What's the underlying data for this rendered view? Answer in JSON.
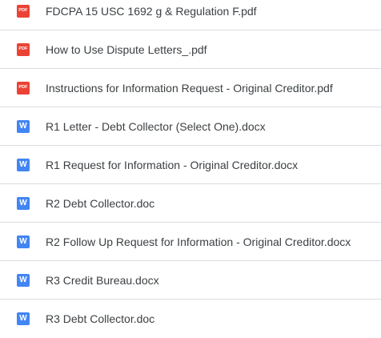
{
  "files": [
    {
      "name": "FDCPA 15 USC 1692 g & Regulation F.pdf",
      "type": "pdf",
      "icon": "pdf-icon",
      "icon_text": "PDF",
      "icon_color": "#ea4335"
    },
    {
      "name": "How to Use Dispute Letters_.pdf",
      "type": "pdf",
      "icon": "pdf-icon",
      "icon_text": "PDF",
      "icon_color": "#ea4335"
    },
    {
      "name": "Instructions for Information Request - Original Creditor.pdf",
      "type": "pdf",
      "icon": "pdf-icon",
      "icon_text": "PDF",
      "icon_color": "#ea4335"
    },
    {
      "name": "R1 Letter - Debt Collector (Select One).docx",
      "type": "word",
      "icon": "word-icon",
      "icon_text": "W",
      "icon_color": "#4285f4"
    },
    {
      "name": "R1 Request for Information - Original Creditor.docx",
      "type": "word",
      "icon": "word-icon",
      "icon_text": "W",
      "icon_color": "#4285f4"
    },
    {
      "name": "R2 Debt Collector.doc",
      "type": "word",
      "icon": "word-icon",
      "icon_text": "W",
      "icon_color": "#4285f4"
    },
    {
      "name": "R2 Follow Up Request for Information - Original Creditor.docx",
      "type": "word",
      "icon": "word-icon",
      "icon_text": "W",
      "icon_color": "#4285f4"
    },
    {
      "name": "R3 Credit Bureau.docx",
      "type": "word",
      "icon": "word-icon",
      "icon_text": "W",
      "icon_color": "#4285f4"
    },
    {
      "name": "R3 Debt Collector.doc",
      "type": "word",
      "icon": "word-icon",
      "icon_text": "W",
      "icon_color": "#4285f4"
    }
  ]
}
